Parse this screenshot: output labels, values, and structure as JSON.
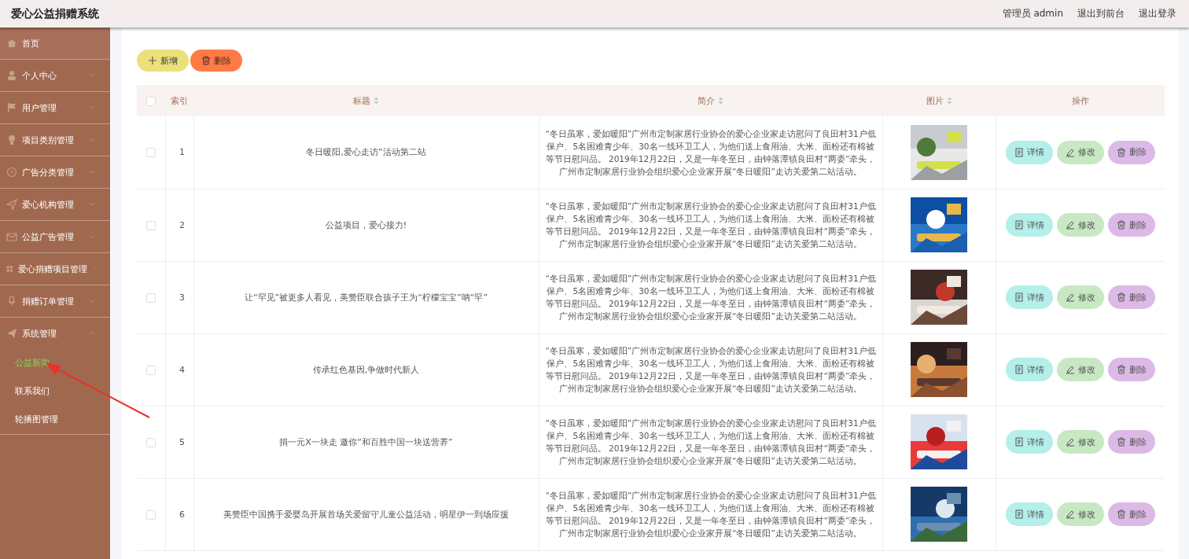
{
  "header": {
    "title": "爱心公益捐赠系统",
    "links": [
      "管理员 admin",
      "退出到前台",
      "退出登录"
    ]
  },
  "sidebar": {
    "items": [
      {
        "label": "首页",
        "selected": false
      },
      {
        "label": "个人中心",
        "selected": false,
        "expanded": false
      },
      {
        "label": "用户管理",
        "selected": false,
        "expanded": false
      },
      {
        "label": "项目类别管理",
        "selected": false,
        "expanded": false
      },
      {
        "label": "广告分类管理",
        "selected": false,
        "expanded": false
      },
      {
        "label": "爱心机构管理",
        "selected": false,
        "expanded": false
      },
      {
        "label": "公益广告管理",
        "selected": false,
        "expanded": false
      },
      {
        "label": "爱心捐赠项目管理",
        "selected": false,
        "expanded": false
      },
      {
        "label": "捐赠订单管理",
        "selected": false,
        "expanded": false
      },
      {
        "label": "系统管理",
        "selected": false,
        "expanded": true,
        "children": [
          {
            "label": "公益新闻",
            "selected": true
          },
          {
            "label": "联系我们",
            "selected": false
          },
          {
            "label": "轮播图管理",
            "selected": false
          }
        ]
      }
    ]
  },
  "toolbar": {
    "buttons": [
      {
        "label": "新增",
        "kind": "add"
      },
      {
        "label": "删除",
        "kind": "delete"
      }
    ]
  },
  "table": {
    "select_all": {
      "checked": false
    },
    "columns": [
      {
        "label": "索引",
        "sortable": false
      },
      {
        "label": "标题",
        "sortable": true
      },
      {
        "label": "简介",
        "sortable": true
      },
      {
        "label": "图片",
        "sortable": true
      },
      {
        "label": "操作",
        "sortable": false
      }
    ],
    "rows": [
      {
        "checked": false,
        "index": "1",
        "title": "冬日暖阳,爱心走访”活动第二站",
        "summary": "“冬日虽寒，爱如暖阳”广州市定制家居行业协会的爱心企业家走访慰问了良田村31户低保户、5名困难青少年、30名一线环卫工人，为他们送上食用油、大米、面粉还有棉被等节日慰问品。 2019年12月22日，又是一年冬至日，由钟落潭镇良田村“两委”牵头，广州市定制家居行业协会组织爱心企业家开展“冬日暖阳”走访关爱第二站活动。",
        "actions": [
          "详情",
          "修改",
          "删除"
        ]
      },
      {
        "checked": false,
        "index": "2",
        "title": "公益项目，爱心接力!",
        "summary": "“冬日虽寒，爱如暖阳”广州市定制家居行业协会的爱心企业家走访慰问了良田村31户低保户、5名困难青少年、30名一线环卫工人，为他们送上食用油、大米、面粉还有棉被等节日慰问品。 2019年12月22日，又是一年冬至日，由钟落潭镇良田村“两委”牵头，广州市定制家居行业协会组织爱心企业家开展“冬日暖阳”走访关爱第二站活动。",
        "actions": [
          "详情",
          "修改",
          "删除"
        ]
      },
      {
        "checked": false,
        "index": "3",
        "title": "让“罕见”被更多人看见，美赞臣联合孩子王为“柠檬宝宝”呐“罕”",
        "summary": "“冬日虽寒，爱如暖阳”广州市定制家居行业协会的爱心企业家走访慰问了良田村31户低保户、5名困难青少年、30名一线环卫工人，为他们送上食用油、大米、面粉还有棉被等节日慰问品。 2019年12月22日，又是一年冬至日，由钟落潭镇良田村“两委”牵头，广州市定制家居行业协会组织爱心企业家开展“冬日暖阳”走访关爱第二站活动。",
        "actions": [
          "详情",
          "修改",
          "删除"
        ]
      },
      {
        "checked": false,
        "index": "4",
        "title": "传承红色基因,争做时代新人",
        "summary": "“冬日虽寒，爱如暖阳”广州市定制家居行业协会的爱心企业家走访慰问了良田村31户低保户、5名困难青少年、30名一线环卫工人，为他们送上食用油、大米、面粉还有棉被等节日慰问品。 2019年12月22日，又是一年冬至日，由钟落潭镇良田村“两委”牵头，广州市定制家居行业协会组织爱心企业家开展“冬日暖阳”走访关爱第二站活动。",
        "actions": [
          "详情",
          "修改",
          "删除"
        ]
      },
      {
        "checked": false,
        "index": "5",
        "title": "捐一元X一块走 邀你“和百胜中国一块送营养”",
        "summary": "“冬日虽寒，爱如暖阳”广州市定制家居行业协会的爱心企业家走访慰问了良田村31户低保户、5名困难青少年、30名一线环卫工人，为他们送上食用油、大米、面粉还有棉被等节日慰问品。 2019年12月22日，又是一年冬至日，由钟落潭镇良田村“两委”牵头，广州市定制家居行业协会组织爱心企业家开展“冬日暖阳”走访关爱第二站活动。",
        "actions": [
          "详情",
          "修改",
          "删除"
        ]
      },
      {
        "checked": false,
        "index": "6",
        "title": "美赞臣中国携手爱婴岛开展首场关爱留守儿童公益活动，明星伊一到场应援",
        "summary": "“冬日虽寒，爱如暖阳”广州市定制家居行业协会的爱心企业家走访慰问了良田村31户低保户、5名困难青少年、30名一线环卫工人，为他们送上食用油、大米、面粉还有棉被等节日慰问品。 2019年12月22日，又是一年冬至日，由钟落潭镇良田村“两委”牵头，广州市定制家居行业协会组织爱心企业家开展“冬日暖阳”走访关爱第二站活动。",
        "actions": [
          "详情",
          "修改",
          "删除"
        ]
      }
    ]
  }
}
